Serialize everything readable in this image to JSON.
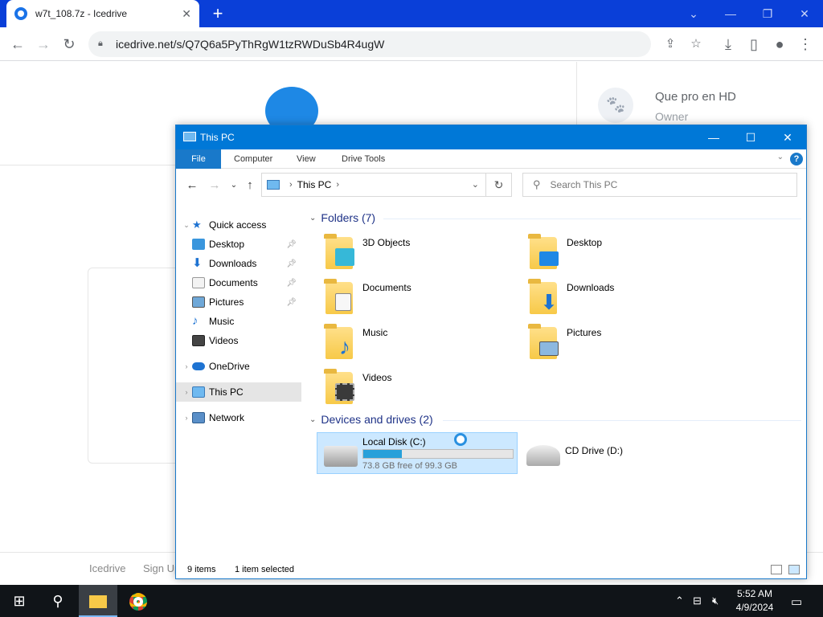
{
  "browser": {
    "tab_title": "w7t_108.7z - Icedrive",
    "tab_close": "✕",
    "new_tab": "+",
    "url": "icedrive.net/s/Q7Q6a5PyThRgW1tzRWDuSb4R4ugW",
    "window_controls": [
      "⌄",
      "—",
      "❐",
      "✕"
    ]
  },
  "web": {
    "owner_name": "Que pro en HD",
    "owner_role": "Owner",
    "footer_links": [
      "Icedrive",
      "Sign Up"
    ]
  },
  "explorer": {
    "title": "This PC",
    "ribbon_tabs": [
      "File",
      "Computer",
      "View",
      "Drive Tools"
    ],
    "address": "This PC",
    "search_placeholder": "Search This PC",
    "nav": {
      "quick_access": "Quick access",
      "quick_items": [
        "Desktop",
        "Downloads",
        "Documents",
        "Pictures",
        "Music",
        "Videos"
      ],
      "onedrive": "OneDrive",
      "this_pc": "This PC",
      "network": "Network"
    },
    "folders_header": "Folders (7)",
    "folders": [
      "3D Objects",
      "Desktop",
      "Documents",
      "Downloads",
      "Music",
      "Pictures",
      "Videos"
    ],
    "devices_header": "Devices and drives (2)",
    "drives": [
      {
        "name": "Local Disk (C:)",
        "free_text": "73.8 GB free of 99.3 GB",
        "used_fraction": 0.257
      },
      {
        "name": "CD Drive (D:)"
      }
    ],
    "status": {
      "items": "9 items",
      "selected": "1 item selected"
    }
  },
  "taskbar": {
    "time": "5:52 AM",
    "date": "4/9/2024"
  }
}
